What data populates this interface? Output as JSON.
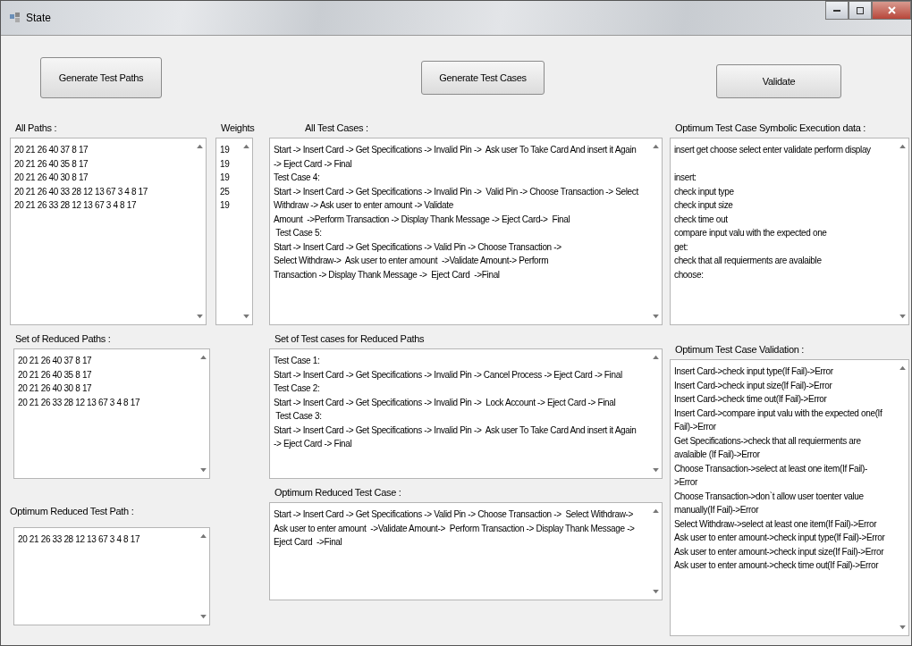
{
  "window": {
    "title": "State"
  },
  "buttons": [
    {
      "label": "Generate Test Paths"
    },
    {
      "label": "Generate Test Cases"
    },
    {
      "label": "Validate"
    }
  ],
  "all_paths": {
    "label": "All Paths :",
    "lines": [
      "20 21 26 40 37 8 17",
      "20 21 26 40 35 8 17",
      "20 21 26 40 30 8 17",
      "20 21 26 40 33 28 12 13 67 3 4 8 17",
      "20 21 26 33 28 12 13 67 3 4 8 17"
    ]
  },
  "weights": {
    "label": "Weights",
    "lines": [
      "19",
      "19",
      "19",
      "25",
      "19"
    ]
  },
  "all_test_cases": {
    "label": "All Test Cases :",
    "lines": [
      "Start -> Insert Card -> Get Specifications -> Invalid Pin ->  Ask user To Take Card And insert it Again",
      "-> Eject Card -> Final",
      "Test Case 4:",
      "Start -> Insert Card -> Get Specifications -> Invalid Pin ->  Valid Pin -> Choose Transaction -> Select",
      "Withdraw -> Ask user to enter amount -> Validate",
      "Amount  ->Perform Transaction -> Display Thank Message -> Eject Card->  Final",
      " Test Case 5:",
      "Start -> Insert Card -> Get Specifications -> Valid Pin -> Choose Transaction ->",
      "Select Withdraw->  Ask user to enter amount  ->Validate Amount-> Perform",
      "Transaction -> Display Thank Message ->  Eject Card  ->Final"
    ]
  },
  "symbolic_execution": {
    "label": "Optimum Test Case Symbolic Execution data :",
    "summary": "insert get choose select enter validate perform display",
    "lines": [
      "insert:",
      "check input type",
      "check input size",
      "check time out",
      "compare input valu with the expected one",
      "get:",
      "check that all requierments are avalaible",
      "choose:"
    ]
  },
  "reduced_paths": {
    "label": "Set of Reduced Paths :",
    "lines": [
      "20 21 26 40 37 8 17",
      "20 21 26 40 35 8 17",
      "20 21 26 40 30 8 17",
      "20 21 26 33 28 12 13 67 3 4 8 17"
    ]
  },
  "reduced_test_cases": {
    "label": "Set of Test cases for Reduced Paths",
    "lines": [
      "Test Case 1:",
      "Start -> Insert Card -> Get Specifications -> Invalid Pin -> Cancel Process -> Eject Card -> Final",
      "Test Case 2:",
      "Start -> Insert Card -> Get Specifications -> Invalid Pin ->  Lock Account -> Eject Card -> Final",
      " Test Case 3:",
      "Start -> Insert Card -> Get Specifications -> Invalid Pin ->  Ask user To Take Card And insert it Again",
      "-> Eject Card -> Final"
    ]
  },
  "validation": {
    "label": "Optimum Test Case Validation :",
    "lines": [
      "Insert Card->check input type(If Fail)->Error",
      "Insert Card->check input size(If Fail)->Error",
      "Insert Card->check time out(If Fail)->Error",
      "Insert Card->compare input valu with the expected one(If",
      "Fail)->Error",
      "Get Specifications->check that all requierments are",
      "avalaible (If Fail)->Error",
      "Choose Transaction->select at least one item(If Fail)-",
      ">Error",
      "Choose Transaction->don`t allow user toenter value",
      "manually(If Fail)->Error",
      "Select Withdraw->select at least one item(If Fail)->Error",
      "Ask user to enter amount->check input type(If Fail)->Error",
      "Ask user to enter amount->check input size(If Fail)->Error",
      "Ask user to enter amount->check time out(If Fail)->Error"
    ]
  },
  "optimum_reduced_path": {
    "label": "Optimum Reduced Test Path :",
    "lines": [
      "20 21 26 33 28 12 13 67 3 4 8 17"
    ]
  },
  "optimum_reduced_case": {
    "label": "Optimum Reduced Test Case :",
    "lines": [
      "Start -> Insert Card -> Get Specifications -> Valid Pin -> Choose Transaction ->  Select Withdraw->",
      "Ask user to enter amount  ->Validate Amount->  Perform Transaction -> Display Thank Message ->",
      "Eject Card  ->Final"
    ]
  }
}
